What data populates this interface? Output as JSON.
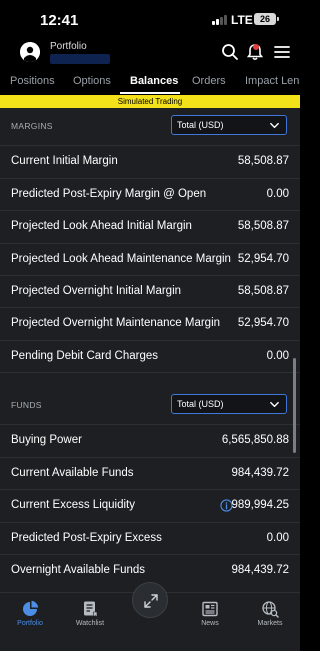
{
  "status_bar": {
    "time": "12:41",
    "network": "LTE",
    "battery": "26"
  },
  "header": {
    "title": "Portfolio"
  },
  "tabs": [
    {
      "label": "Positions",
      "active": false
    },
    {
      "label": "Options",
      "active": false
    },
    {
      "label": "Balances",
      "active": true
    },
    {
      "label": "Orders",
      "active": false
    },
    {
      "label": "Impact Lens",
      "active": false
    }
  ],
  "banner": "Simulated Trading",
  "margins": {
    "title": "MARGINS",
    "currency": "Total (USD)",
    "rows": [
      {
        "label": "Current Initial Margin",
        "value": "58,508.87"
      },
      {
        "label": "Predicted Post-Expiry Margin @ Open",
        "value": "0.00"
      },
      {
        "label": "Projected Look Ahead Initial Margin",
        "value": "58,508.87"
      },
      {
        "label": "Projected Look Ahead Maintenance Margin",
        "value": "52,954.70"
      },
      {
        "label": "Projected Overnight Initial Margin",
        "value": "58,508.87"
      },
      {
        "label": "Projected Overnight Maintenance Margin",
        "value": "52,954.70"
      },
      {
        "label": "Pending Debit Card Charges",
        "value": "0.00"
      }
    ]
  },
  "funds": {
    "title": "FUNDS",
    "currency": "Total (USD)",
    "rows": [
      {
        "label": "Buying Power",
        "value": "6,565,850.88"
      },
      {
        "label": "Current Available Funds",
        "value": "984,439.72"
      },
      {
        "label": "Current Excess Liquidity",
        "value": "989,994.25"
      },
      {
        "label": "Predicted Post-Expiry Excess",
        "value": "0.00"
      },
      {
        "label": "Overnight Available Funds",
        "value": "984,439.72"
      }
    ]
  },
  "bottom_nav": [
    {
      "label": "Portfolio",
      "icon": "pie-chart-icon",
      "active": true
    },
    {
      "label": "Watchlist",
      "icon": "watchlist-icon",
      "active": false
    },
    {
      "label": "",
      "icon": "trade-arrows-icon",
      "active": false
    },
    {
      "label": "News",
      "icon": "newspaper-icon",
      "active": false
    },
    {
      "label": "Markets",
      "icon": "globe-search-icon",
      "active": false
    }
  ],
  "colors": {
    "accent": "#4c8de6",
    "banner": "#f3e21a",
    "background": "#1d1f23",
    "badge": "#e23b3b"
  }
}
